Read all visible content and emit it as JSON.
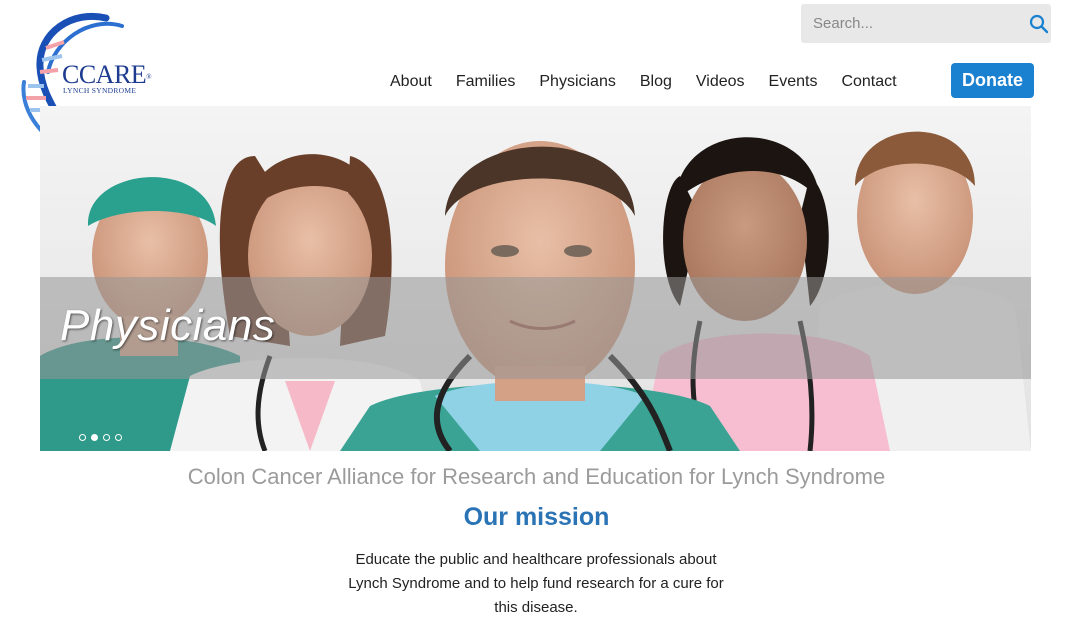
{
  "logo": {
    "name": "CCARE",
    "trademark": "®",
    "subtitle": "LYNCH SYNDROME"
  },
  "search": {
    "placeholder": "Search...",
    "icon": "search-icon"
  },
  "nav": {
    "items": [
      "About",
      "Families",
      "Physicians",
      "Blog",
      "Videos",
      "Events",
      "Contact"
    ],
    "donate_label": "Donate"
  },
  "hero": {
    "caption": "Physicians",
    "slide_count": 4,
    "active_slide": 2
  },
  "tagline": "Colon Cancer Alliance for Research and Education for Lynch Syndrome",
  "mission": {
    "title": "Our mission",
    "text": "Educate the public and healthcare professionals about Lynch Syndrome and to help fund research for a cure for this disease."
  },
  "colors": {
    "accent": "#1a80d0",
    "mission_title": "#2a73b5",
    "logo_navy": "#1d3c8f",
    "tagline": "#9b9b9b"
  }
}
